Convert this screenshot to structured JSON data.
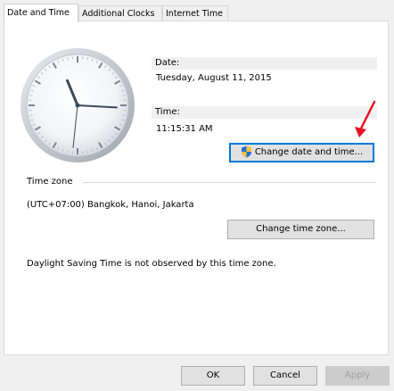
{
  "tabs": [
    {
      "label": "Date and Time"
    },
    {
      "label": "Additional Clocks"
    },
    {
      "label": "Internet Time"
    }
  ],
  "clock": {
    "hour": 11,
    "minute": 15,
    "second": 31
  },
  "date": {
    "label": "Date:",
    "value": "Tuesday, August 11, 2015"
  },
  "time": {
    "label": "Time:",
    "value": "11:15:31 AM"
  },
  "change_date_button": {
    "label": "Change date and time...",
    "icon": "uac-shield-icon"
  },
  "timezone": {
    "section_label": "Time zone",
    "value": "(UTC+07:00) Bangkok, Hanoi, Jakarta",
    "change_button": "Change time zone...",
    "dst_note": "Daylight Saving Time is not observed by this time zone."
  },
  "footer": {
    "ok": "OK",
    "cancel": "Cancel",
    "apply": "Apply"
  },
  "colors": {
    "focus": "#0078d7",
    "annotation_arrow": "#e81123"
  }
}
